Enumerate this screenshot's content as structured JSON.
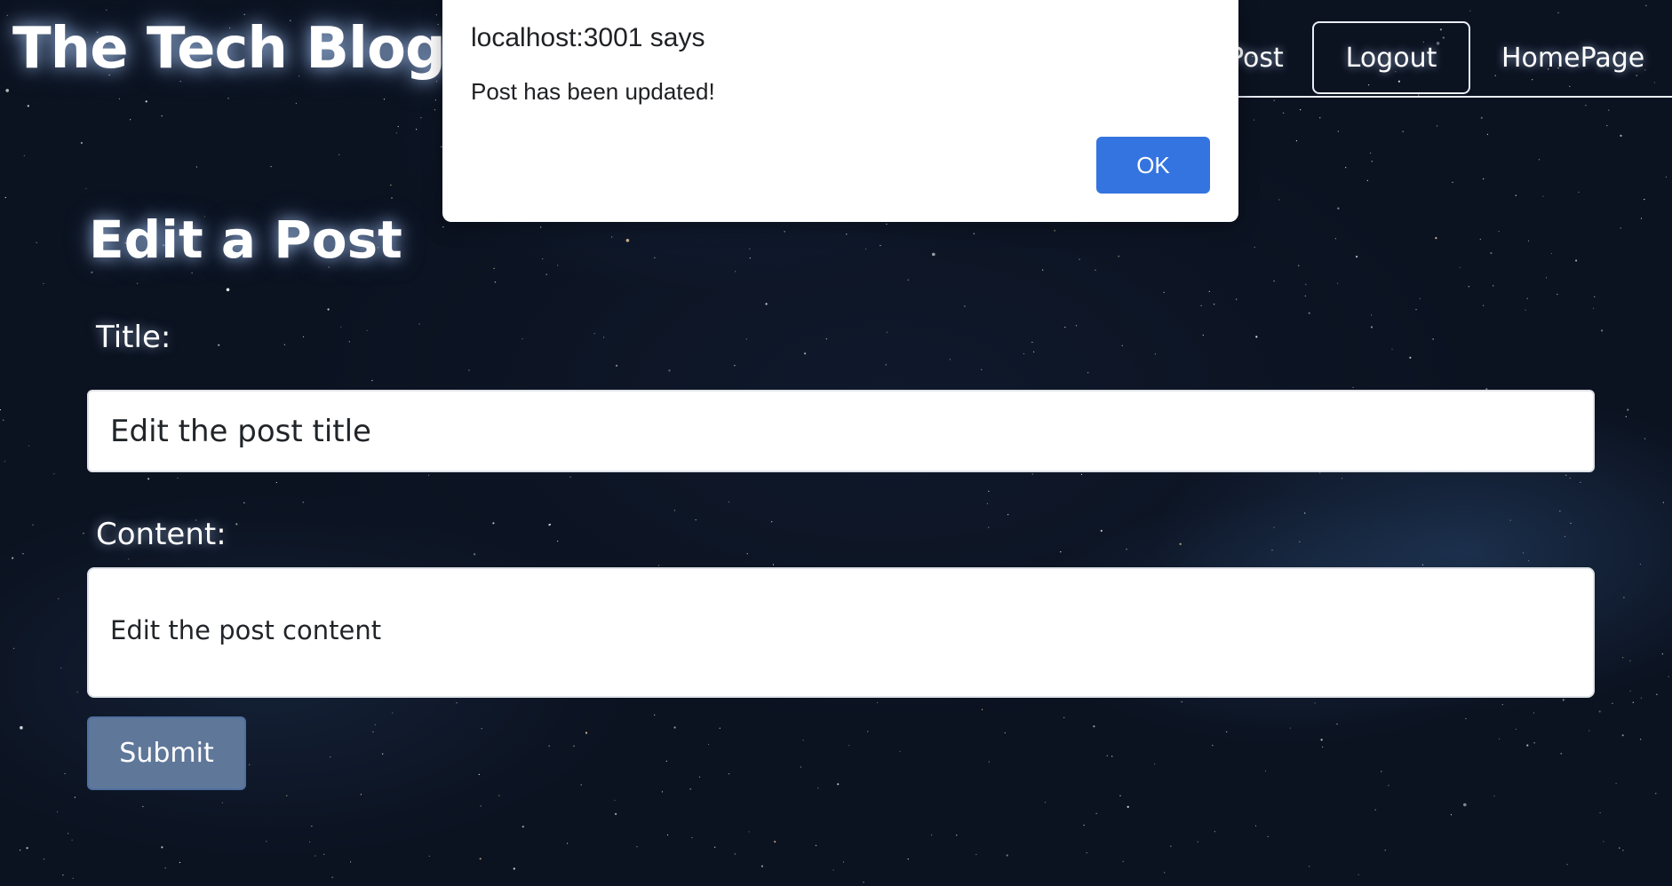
{
  "header": {
    "site_title": "The Tech Blog",
    "nav": {
      "new_post": "Post",
      "logout": "Logout",
      "homepage": "HomePage"
    }
  },
  "form": {
    "heading": "Edit a Post",
    "title_label": "Title:",
    "title_value": "Edit the post title",
    "content_label": "Content:",
    "content_value": "Edit the post content",
    "submit_label": "Submit"
  },
  "dialog": {
    "origin": "localhost:3001 says",
    "message": "Post has been updated!",
    "ok_label": "OK"
  },
  "colors": {
    "background": "#0b1220",
    "dialog_button": "#3474e0",
    "submit_button": "#5f7799"
  }
}
